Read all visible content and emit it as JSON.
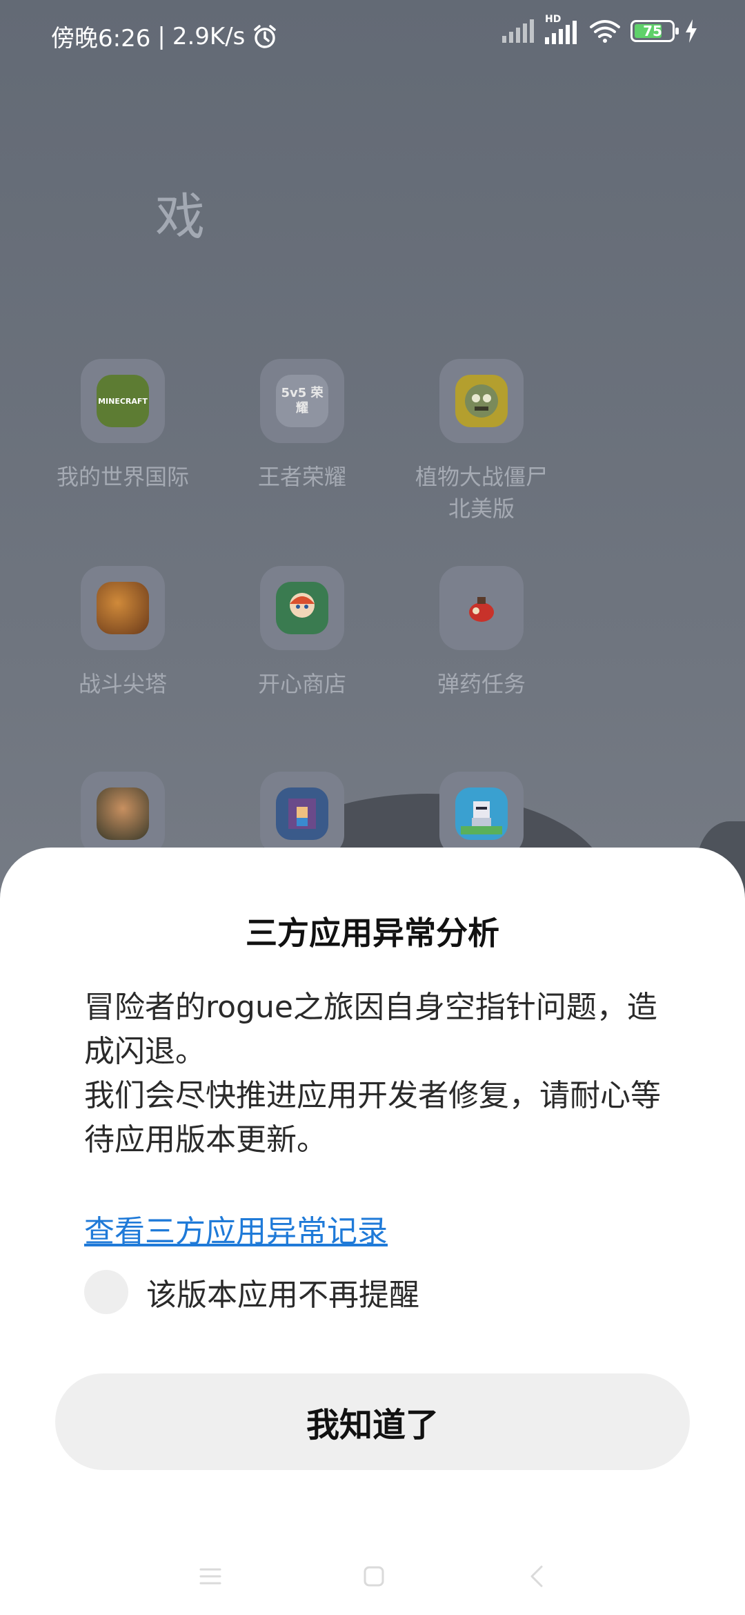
{
  "status_bar": {
    "time": "傍晚6:26",
    "separator": "|",
    "network_speed": "2.9K/s",
    "battery_level": "75",
    "battery_fraction": 0.75,
    "network_badge": "HD",
    "colors": {
      "battery": "#5fd16a",
      "text": "#ffffff"
    }
  },
  "folder": {
    "title": "戏",
    "apps": [
      {
        "label": "我的世界国际",
        "icon": "minecraft-icon",
        "color": "#6b8a3a",
        "glyph": "MINECRAFT"
      },
      {
        "label": "王者荣耀",
        "icon": "honor-of-kings-icon",
        "color": "#8a8f9c",
        "glyph": "5v5 荣耀"
      },
      {
        "label": "植物大战僵尸\n北美版",
        "label_line1": "植物大战僵尸",
        "label_line2": "北美版",
        "icon": "pvz-icon",
        "color": "#b9a431",
        "glyph": ""
      },
      {
        "label": "战斗尖塔",
        "icon": "battle-spire-icon",
        "color": "#9a5a26",
        "glyph": ""
      },
      {
        "label": "开心商店",
        "icon": "happy-shop-icon",
        "color": "#3a7b50",
        "glyph": ""
      },
      {
        "label": "弹药任务",
        "icon": "ammo-mission-icon",
        "color": "#c03a2a",
        "glyph": ""
      },
      {
        "label": "",
        "icon": "soldier-game-icon",
        "color": "#5a6a3a",
        "glyph": ""
      },
      {
        "label": "",
        "icon": "rogue-journey-icon",
        "color": "#3a5a8a",
        "glyph": ""
      },
      {
        "label": "",
        "icon": "knight-game-icon",
        "color": "#3aa0d0",
        "glyph": ""
      }
    ]
  },
  "dialog": {
    "title": "三方应用异常分析",
    "message_line1": "冒险者的rogue之旅因自身空指针问题，造成闪退。",
    "message_line2": "我们会尽快推进应用开发者修复，请耐心等待应用版本更新。",
    "link": "查看三方应用异常记录",
    "checkbox_label": "该版本应用不再提醒",
    "checkbox_checked": false,
    "confirm_button": "我知道了",
    "colors": {
      "link": "#1f7ad8",
      "button_bg": "#efefef"
    }
  },
  "nav_bar": {
    "items": [
      "menu-icon",
      "home-icon",
      "back-icon"
    ]
  }
}
